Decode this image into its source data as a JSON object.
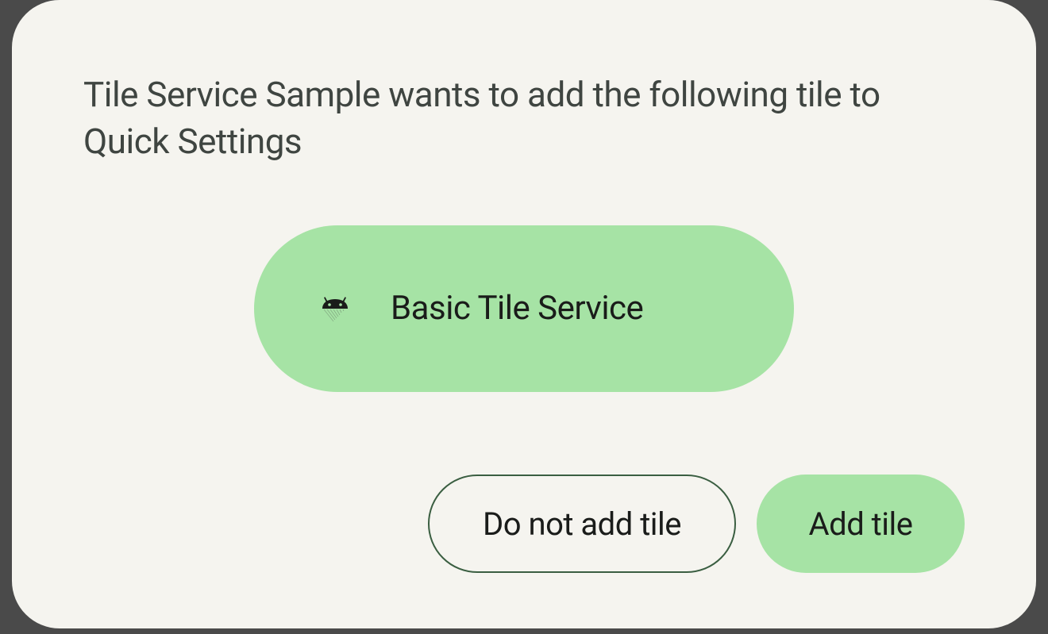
{
  "dialog": {
    "title": "Tile Service Sample wants to add the following tile to Quick Settings"
  },
  "tile": {
    "label": "Basic Tile Service",
    "icon": "android-icon"
  },
  "buttons": {
    "cancel_label": "Do not add tile",
    "confirm_label": "Add tile"
  },
  "colors": {
    "background": "#f5f4ef",
    "accent": "#a6e3a5",
    "outline": "#3a5e41",
    "text": "#3f4541"
  }
}
